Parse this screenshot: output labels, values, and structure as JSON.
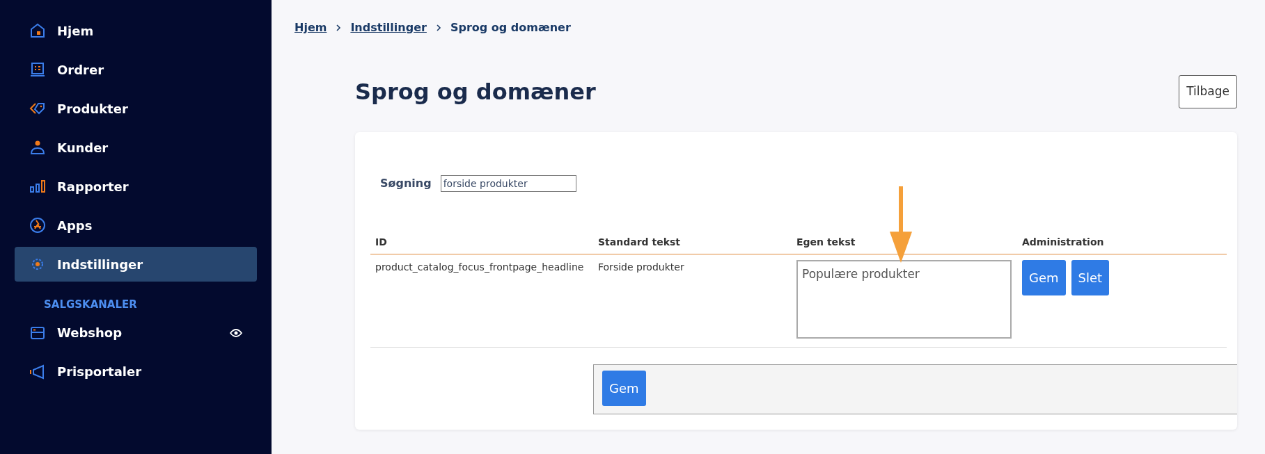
{
  "sidebar": {
    "items": [
      {
        "label": "Hjem",
        "selected": false
      },
      {
        "label": "Ordrer",
        "selected": false
      },
      {
        "label": "Produkter",
        "selected": false
      },
      {
        "label": "Kunder",
        "selected": false
      },
      {
        "label": "Rapporter",
        "selected": false
      },
      {
        "label": "Apps",
        "selected": false
      },
      {
        "label": "Indstillinger",
        "selected": true
      }
    ],
    "section_title": "SALGSKANALER",
    "channels": [
      {
        "label": "Webshop",
        "selected": false,
        "visible": true
      },
      {
        "label": "Prisportaler",
        "selected": false,
        "visible": false
      }
    ]
  },
  "breadcrumb": [
    {
      "label": "Hjem",
      "link": true
    },
    {
      "label": "Indstillinger",
      "link": true
    },
    {
      "label": "Sprog og domæner",
      "link": false
    }
  ],
  "page_title": "Sprog og domæner",
  "back_button": "Tilbage",
  "search": {
    "label": "Søgning",
    "value": "forside produkter"
  },
  "table": {
    "columns": [
      "ID",
      "Standard tekst",
      "Egen tekst",
      "Administration"
    ],
    "rows": [
      {
        "id": "product_catalog_focus_frontpage_headline",
        "standard": "Forside produkter",
        "custom": "Populære produkter",
        "buttons": [
          "Gem",
          "Slet"
        ]
      }
    ]
  },
  "footer_button": "Gem"
}
